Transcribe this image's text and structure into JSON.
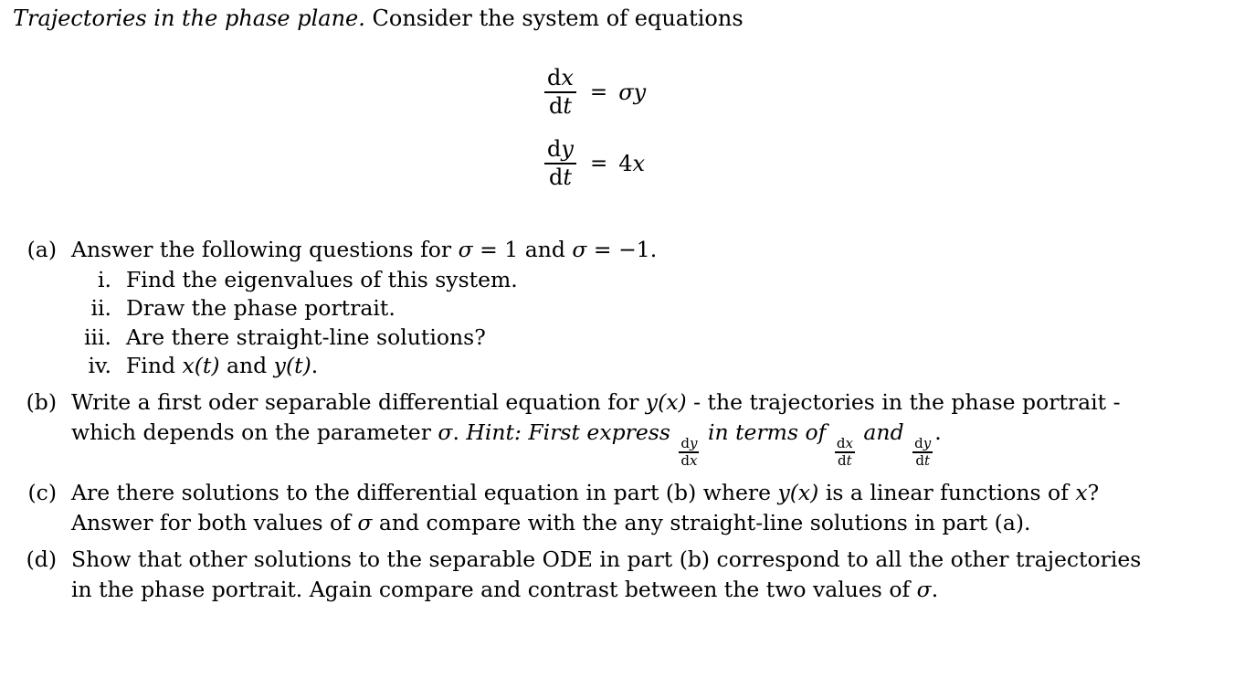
{
  "document": {
    "intro": {
      "title_italic": "Trajectories in the phase plane.",
      "lead_text": "Consider the system of equations"
    },
    "equations": [
      {
        "id": "eq-dxdt",
        "numerator": "dx",
        "num_d": "d",
        "num_var": "x",
        "denominator": "dt",
        "den_d": "d",
        "den_var": "t",
        "relation": "=",
        "rhs": "σy",
        "rhs_coef": "σ",
        "rhs_var": "y"
      },
      {
        "id": "eq-dydt",
        "numerator": "dy",
        "num_d": "d",
        "num_var": "y",
        "denominator": "dt",
        "den_d": "d",
        "den_var": "t",
        "relation": "=",
        "rhs": "4x",
        "rhs_coef": "4",
        "rhs_var": "x"
      }
    ],
    "items": {
      "a": {
        "label": "(a)",
        "text_before": "Answer the following questions for ",
        "sigma1": "σ",
        "eq1": " = 1 and ",
        "sigma2": "σ",
        "eq2": " = −1.",
        "subitems": [
          {
            "label": "i.",
            "text": "Find the eigenvalues of this system."
          },
          {
            "label": "ii.",
            "text": "Draw the phase portrait."
          },
          {
            "label": "iii.",
            "text": "Are there straight-line solutions?"
          },
          {
            "label": "iv.",
            "text_a": "Find ",
            "var_x": "x",
            "paren_t1": "(t)",
            "text_b": " and ",
            "var_y": "y",
            "paren_t2": "(t)",
            "text_c": "."
          }
        ]
      },
      "b": {
        "label": "(b)",
        "line1_a": "Write a first oder separable differential equation for ",
        "line1_yx_y": "y",
        "line1_yx_x": "(x)",
        "line1_b": " - the trajectories in the phase portrait -",
        "line2_a": "which depends on the parameter ",
        "line2_sigma": "σ",
        "line2_b": ". ",
        "hint_label": "Hint: First express",
        "hint_mid": "in terms of",
        "hint_and": "and",
        "hint_end": ".",
        "hint_frac1_num_d": "d",
        "hint_frac1_num_v": "y",
        "hint_frac1_den_d": "d",
        "hint_frac1_den_v": "x",
        "hint_frac2_num_d": "d",
        "hint_frac2_num_v": "x",
        "hint_frac2_den_d": "d",
        "hint_frac2_den_v": "t",
        "hint_frac3_num_d": "d",
        "hint_frac3_num_v": "y",
        "hint_frac3_den_d": "d",
        "hint_frac3_den_v": "t"
      },
      "c": {
        "label": "(c)",
        "line1_a": "Are there solutions to the differential equation in part (b) where ",
        "line1_y": "y",
        "line1_x": "(x)",
        "line1_b": " is a linear functions of ",
        "line1_var": "x",
        "line1_c": "?",
        "line2_a": "Answer for both values of ",
        "line2_sigma": "σ",
        "line2_b": " and compare with the any straight-line solutions in part (a)."
      },
      "d": {
        "label": "(d)",
        "line1": "Show that other solutions to the separable ODE in part (b) correspond to all the other trajectories",
        "line2_a": "in the phase portrait. Again compare and contrast between the two values of ",
        "line2_sigma": "σ",
        "line2_b": "."
      }
    }
  }
}
